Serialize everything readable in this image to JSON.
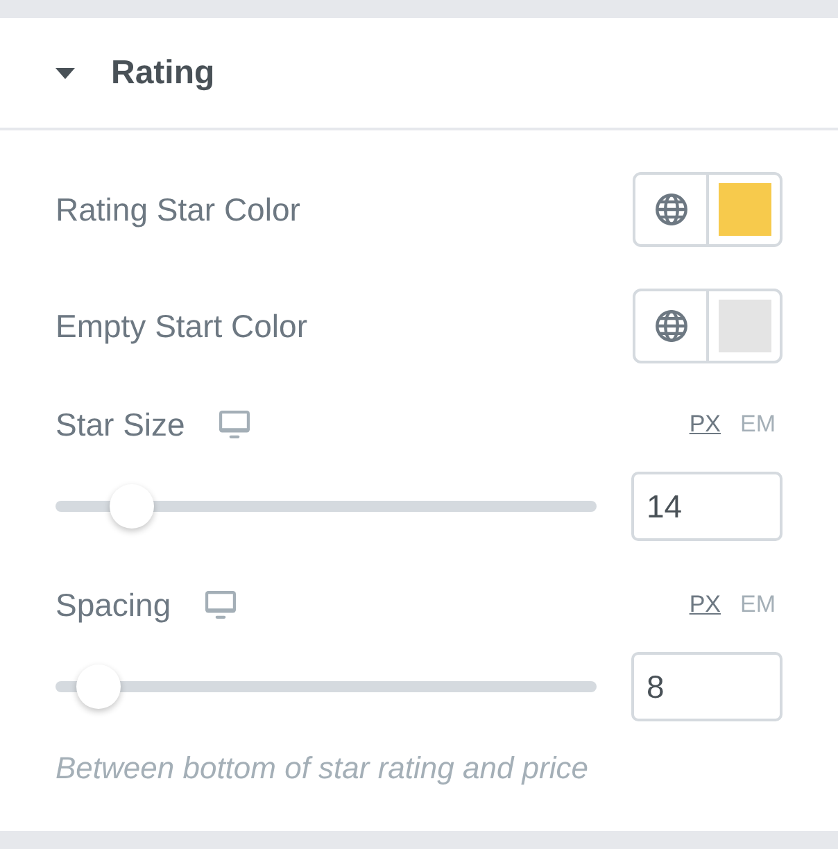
{
  "section": {
    "title": "Rating",
    "expanded": true
  },
  "controls": [
    {
      "kind": "color",
      "label": "Rating Star Color",
      "color": "#f7ca4c"
    },
    {
      "kind": "color",
      "label": "Empty Start Color",
      "color": "#e4e4e4"
    },
    {
      "kind": "slider",
      "label": "Star Size",
      "units": [
        {
          "label": "PX",
          "selected": true
        },
        {
          "label": "EM",
          "selected": false
        }
      ],
      "level": 0.14,
      "value": "14"
    },
    {
      "kind": "slider",
      "label": "Spacing",
      "units": [
        {
          "label": "PX",
          "selected": true
        },
        {
          "label": "EM",
          "selected": false
        }
      ],
      "level": 0.08,
      "value": "8",
      "description": "Between bottom of star rating and price"
    }
  ]
}
